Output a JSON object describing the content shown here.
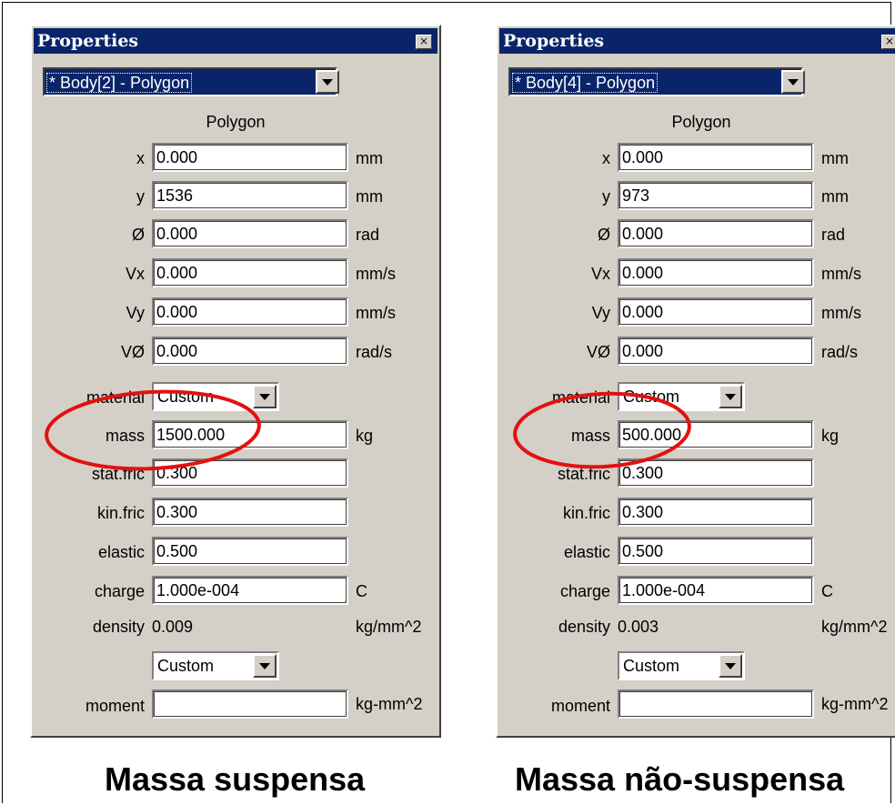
{
  "panels": [
    {
      "title": "Properties",
      "close_glyph": "×",
      "body_select": "* Body[2] - Polygon",
      "subtitle": "Polygon",
      "rows": [
        {
          "label": "x",
          "value": "0.000",
          "unit": "mm"
        },
        {
          "label": "y",
          "value": "1536",
          "unit": "mm"
        },
        {
          "label": "Ø",
          "value": "0.000",
          "unit": "rad"
        },
        {
          "label": "Vx",
          "value": "0.000",
          "unit": "mm/s"
        },
        {
          "label": "Vy",
          "value": "0.000",
          "unit": "mm/s"
        },
        {
          "label": "VØ",
          "value": "0.000",
          "unit": "rad/s"
        }
      ],
      "material_label": "material",
      "material_value": "Custom",
      "mass_label": "mass",
      "mass_value": "1500.000",
      "mass_unit": "kg",
      "stat_fric_label": "stat.fric",
      "stat_fric_value": "0.300",
      "kin_fric_label": "kin.fric",
      "kin_fric_value": "0.300",
      "elastic_label": "elastic",
      "elastic_value": "0.500",
      "charge_label": "charge",
      "charge_value": "1.000e-004",
      "charge_unit": "C",
      "density_label": "density",
      "density_value": "0.009",
      "density_unit": "kg/mm^2",
      "moment_combo": "Custom",
      "moment_label": "moment",
      "moment_value": "",
      "moment_unit": "kg-mm^2"
    },
    {
      "title": "Properties",
      "close_glyph": "×",
      "body_select": "* Body[4] - Polygon",
      "subtitle": "Polygon",
      "rows": [
        {
          "label": "x",
          "value": "0.000",
          "unit": "mm"
        },
        {
          "label": "y",
          "value": "973",
          "unit": "mm"
        },
        {
          "label": "Ø",
          "value": "0.000",
          "unit": "rad"
        },
        {
          "label": "Vx",
          "value": "0.000",
          "unit": "mm/s"
        },
        {
          "label": "Vy",
          "value": "0.000",
          "unit": "mm/s"
        },
        {
          "label": "VØ",
          "value": "0.000",
          "unit": "rad/s"
        }
      ],
      "material_label": "material",
      "material_value": "Custom",
      "mass_label": "mass",
      "mass_value": "500.000",
      "mass_unit": "kg",
      "stat_fric_label": "stat.fric",
      "stat_fric_value": "0.300",
      "kin_fric_label": "kin.fric",
      "kin_fric_value": "0.300",
      "elastic_label": "elastic",
      "elastic_value": "0.500",
      "charge_label": "charge",
      "charge_value": "1.000e-004",
      "charge_unit": "C",
      "density_label": "density",
      "density_value": "0.003",
      "density_unit": "kg/mm^2",
      "moment_combo": "Custom",
      "moment_label": "moment",
      "moment_value": "",
      "moment_unit": "kg-mm^2"
    }
  ],
  "captions": [
    "Massa suspensa",
    "Massa não-suspensa"
  ],
  "colors": {
    "highlight_ellipse": "#e41010",
    "titlebar": "#0a246a",
    "panel": "#d4d0c8"
  }
}
